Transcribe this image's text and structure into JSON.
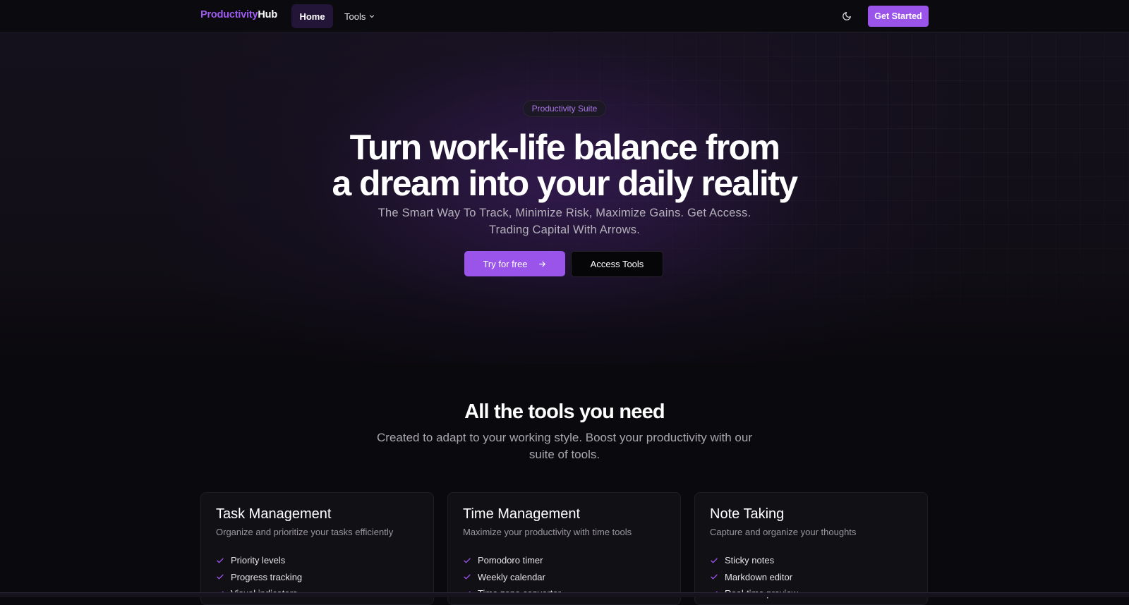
{
  "nav": {
    "logo_accent": "Productivity",
    "logo_rest": "Hub",
    "home_label": "Home",
    "tools_label": "Tools",
    "tools_icon": "chevron-down-icon",
    "theme_icon": "moon-icon",
    "cta_label": "Get Started"
  },
  "hero": {
    "badge": "Productivity Suite",
    "title_line1": "Turn work-life balance from",
    "title_line2": "a dream into your daily reality",
    "subtitle_line1": "The Smart Way To Track, Minimize Risk, Maximize Gains. Get Access.",
    "subtitle_line2": "Trading Capital With Arrows.",
    "primary_button": "Try for free",
    "primary_button_icon": "arrow-right-icon",
    "secondary_button": "Access Tools"
  },
  "tools": {
    "title": "All the tools you need",
    "subtitle_line1": "Created to adapt to your working style. Boost your productivity with our",
    "subtitle_line2": "suite of tools.",
    "cards": [
      {
        "title": "Task Management",
        "description": "Organize and prioritize your tasks efficiently",
        "features": [
          "Priority levels",
          "Progress tracking",
          "Visual indicators"
        ]
      },
      {
        "title": "Time Management",
        "description": "Maximize your productivity with time tools",
        "features": [
          "Pomodoro timer",
          "Weekly calendar",
          "Time zone converter"
        ]
      },
      {
        "title": "Note Taking",
        "description": "Capture and organize your thoughts",
        "features": [
          "Sticky notes",
          "Markdown editor",
          "Real-time preview"
        ]
      }
    ]
  },
  "colors": {
    "accent": "#9a54ea",
    "background": "#0a090d",
    "card": "#111015"
  }
}
